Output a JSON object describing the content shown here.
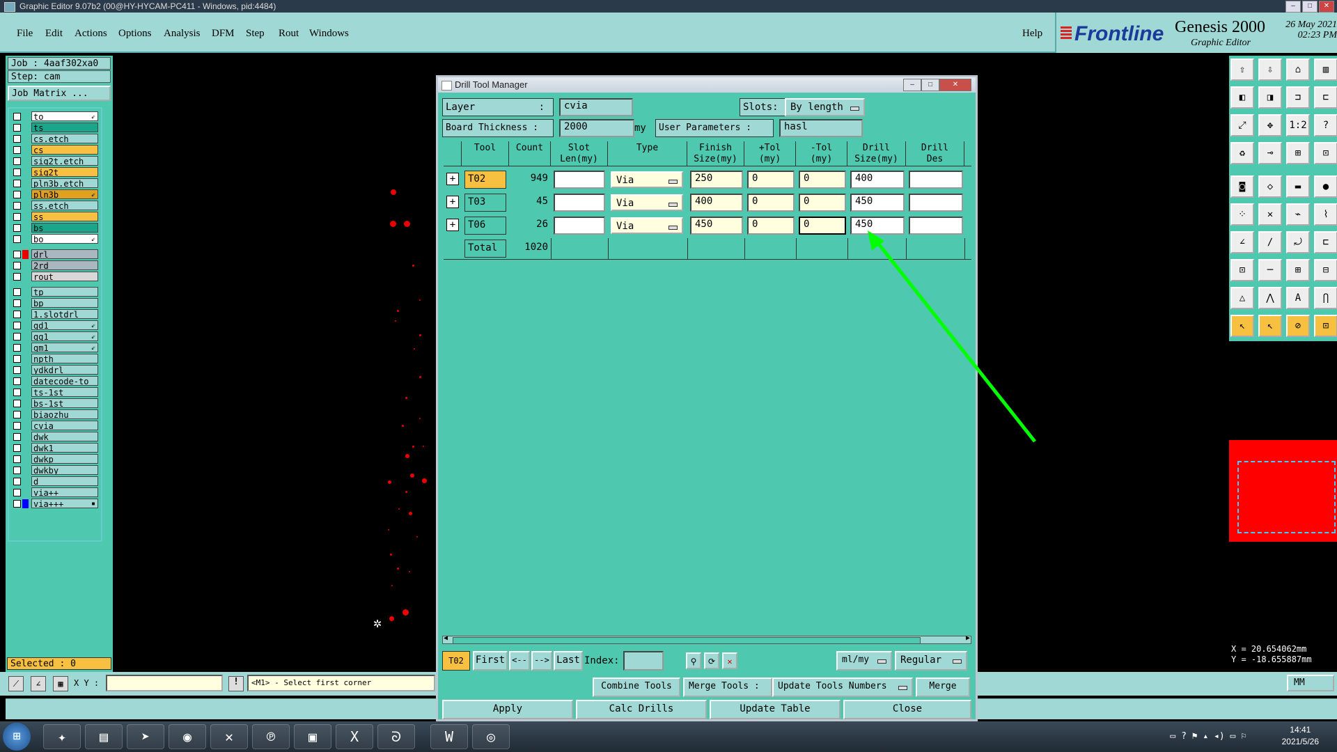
{
  "window_title": "Graphic Editor 9.07b2 (00@HY-HYCAM-PC411 - Windows, pid:4484)",
  "menu": [
    "File",
    "Edit",
    "Actions",
    "Options",
    "Analysis",
    "DFM",
    "Step",
    "Rout",
    "Windows"
  ],
  "help_label": "Help",
  "brand": {
    "logo": "Frontline",
    "product": "Genesis 2000",
    "subtitle": "Graphic Editor",
    "date": "26 May 2021",
    "time": "02:23 PM"
  },
  "job": {
    "job_line": "Job : 4aaf302xa0",
    "step_line": "Step: cam",
    "matrix_button": "Job Matrix ..."
  },
  "layers": [
    {
      "name": "to",
      "color": "#ffffff",
      "mark": "⇙"
    },
    {
      "name": "ts",
      "color": "#1aa68a"
    },
    {
      "name": "cs.etch",
      "color": "#9fd8d4"
    },
    {
      "name": "cs",
      "color": "#f8c040"
    },
    {
      "name": "sig2t.etch",
      "color": "#9fd8d4"
    },
    {
      "name": "sig2t",
      "color": "#f8c040"
    },
    {
      "name": "pln3b.etch",
      "color": "#9fd8d4"
    },
    {
      "name": "pln3b",
      "color": "#e0a020",
      "mark": "⇙"
    },
    {
      "name": "ss.etch",
      "color": "#9fd8d4"
    },
    {
      "name": "ss",
      "color": "#f8c040"
    },
    {
      "name": "bs",
      "color": "#1aa68a"
    },
    {
      "name": "bo",
      "color": "#ffffff",
      "mark": "⇙"
    },
    {
      "name": "drl",
      "color": "#a9b8c0",
      "swatch": "#e00"
    },
    {
      "name": "2rd",
      "color": "#a9b8c0"
    },
    {
      "name": "rout",
      "color": "#d8d8d8"
    },
    {
      "name": "tp",
      "color": "#9fd8d4"
    },
    {
      "name": "bp",
      "color": "#9fd8d4"
    },
    {
      "name": "1.slotdrl",
      "color": "#9fd8d4"
    },
    {
      "name": "gd1",
      "color": "#9fd8d4",
      "mark": "⇙"
    },
    {
      "name": "gg1",
      "color": "#9fd8d4",
      "mark": "⇙"
    },
    {
      "name": "gm1",
      "color": "#9fd8d4",
      "mark": "⇙"
    },
    {
      "name": "npth",
      "color": "#9fd8d4"
    },
    {
      "name": "ydkdrl",
      "color": "#9fd8d4"
    },
    {
      "name": "datecode-to",
      "color": "#9fd8d4"
    },
    {
      "name": "ts-1st",
      "color": "#9fd8d4"
    },
    {
      "name": "bs-1st",
      "color": "#9fd8d4"
    },
    {
      "name": "biaozhu",
      "color": "#9fd8d4"
    },
    {
      "name": "cvia",
      "color": "#9fd8d4"
    },
    {
      "name": "dwk",
      "color": "#9fd8d4"
    },
    {
      "name": "dwk1",
      "color": "#9fd8d4"
    },
    {
      "name": "dwkp",
      "color": "#9fd8d4"
    },
    {
      "name": "dwkby",
      "color": "#9fd8d4"
    },
    {
      "name": "d",
      "color": "#9fd8d4"
    },
    {
      "name": "via++",
      "color": "#9fd8d4"
    },
    {
      "name": "via+++",
      "color": "#9fd8d4",
      "swatch": "#00f",
      "mark": "▪"
    }
  ],
  "selected_label": "Selected : 0",
  "coordinates": {
    "x": "X = 20.654062mm",
    "y": "Y = -18.655887mm"
  },
  "bottom": {
    "xy_label": "X Y :",
    "xy_value": "",
    "prompt": "<M1> - Select first corner",
    "units": "MM"
  },
  "dialog": {
    "title": "Drill Tool Manager",
    "layer_label": "Layer",
    "layer_value": "cvia",
    "slots_label": "Slots:",
    "slots_value": "By length",
    "thickness_label": "Board Thickness :",
    "thickness_value": "2000",
    "thickness_unit": "my",
    "user_params_label": "User Parameters :",
    "user_params_value": "hasl",
    "columns": [
      "Tool",
      "Count",
      "Slot\nLen(my)",
      "Type",
      "Finish\nSize(my)",
      "+Tol\n(my)",
      "-Tol\n(my)",
      "Drill\nSize(my)",
      "Drill\nDes"
    ],
    "rows": [
      {
        "tool": "T02",
        "count": "949",
        "slot_len": "",
        "type": "Via",
        "finish": "250",
        "ptol": "0",
        "mtol": "0",
        "drill": "400",
        "des": ""
      },
      {
        "tool": "T03",
        "count": "45",
        "slot_len": "",
        "type": "Via",
        "finish": "400",
        "ptol": "0",
        "mtol": "0",
        "drill": "450",
        "des": ""
      },
      {
        "tool": "T06",
        "count": "26",
        "slot_len": "",
        "type": "Via",
        "finish": "450",
        "ptol": "0",
        "mtol": "0",
        "drill": "450",
        "des": ""
      }
    ],
    "total_label": "Total",
    "total_count": "1020",
    "nav": {
      "current": "T02",
      "first": "First",
      "prev": "<--",
      "next": "-->",
      "last": "Last",
      "index_label": "Index:",
      "index_value": "",
      "units": "ml/my",
      "mode": "Regular"
    },
    "actions": {
      "combine": "Combine Tools",
      "merge_tools": "Merge Tools :",
      "update_numbers": "Update Tools Numbers",
      "merge": "Merge"
    },
    "footer": {
      "apply": "Apply",
      "calc": "Calc Drills",
      "update_table": "Update Table",
      "close": "Close"
    }
  },
  "taskbar_clock": {
    "time": "14:41",
    "date": "2021/5/26"
  },
  "annotation_color": "#00ff00"
}
